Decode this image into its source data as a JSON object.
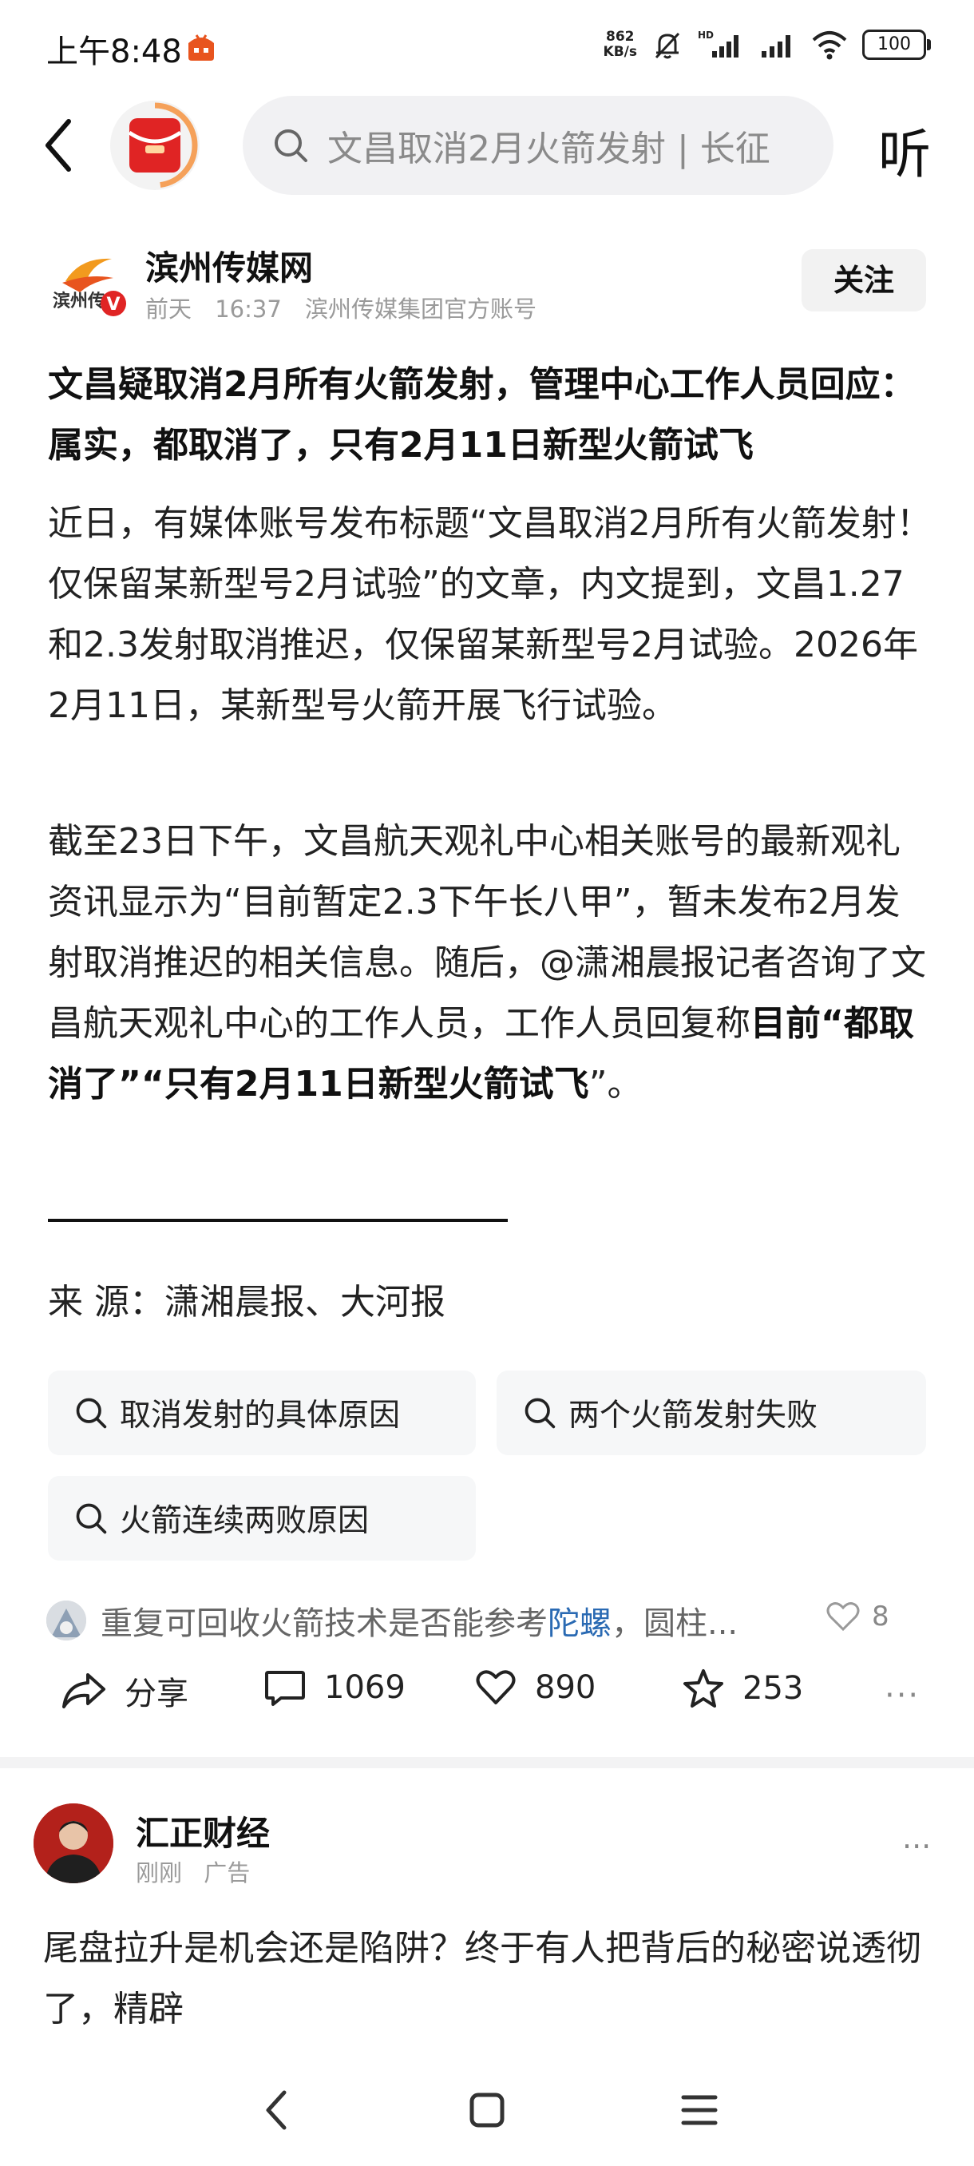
{
  "status_bar": {
    "time": "上午8:48",
    "net_speed_value": "862",
    "net_speed_unit": "KB/s",
    "battery": "100"
  },
  "header": {
    "search_text": "文昌取消2月火箭发射 | 长征",
    "listen_label": "听"
  },
  "author": {
    "name": "滨州传媒网",
    "logo_text": "滨州传",
    "verified_mark": "V",
    "meta": [
      "前天",
      "16:37",
      "滨州传媒集团官方账号"
    ],
    "follow_label": "关注"
  },
  "article": {
    "title": "文昌疑取消2月所有火箭发射，管理中心工作人员回应：属实，都取消了，只有2月11日新型火箭试飞",
    "para1": "近日，有媒体账号发布标题“文昌取消2月所有火箭发射！仅保留某新型号2月试验”的文章，内文提到，文昌1.27和2.3发射取消推迟，仅保留某新型号2月试验。2026年2月11日，某新型号火箭开展飞行试验。",
    "para2_normal": "截至23日下午，文昌航天观礼中心相关账号的最新观礼资讯显示为“目前暂定2.3下午长八甲”，暂未发布2月发射取消推迟的相关信息。随后，@潇湘晨报记者咨询了文昌航天观礼中心的工作人员，工作人员回复称",
    "para2_bold": "目前“都取消了”“只有2月11日新型火箭试飞",
    "para2_end": "”。",
    "source": "来 源：潇湘晨报、大河报"
  },
  "related_searches": [
    "取消发射的具体原因",
    "两个火箭发射失败",
    "火箭连续两败原因"
  ],
  "hot_comment": {
    "prefix": "重复可回收火箭技术是否能参考",
    "highlight": "陀螺",
    "suffix": "，圆柱...",
    "likes": "8"
  },
  "actions": {
    "share_label": "分享",
    "comments": "1069",
    "likes": "890",
    "favorites": "253",
    "more": "···"
  },
  "ad": {
    "name": "汇正财经",
    "meta": [
      "刚刚",
      "广告"
    ],
    "more": "···",
    "text": "尾盘拉升是机会还是陷阱？终于有人把背后的秘密说透彻了，精辟"
  },
  "colors": {
    "accent_red": "#e02424",
    "link_blue": "#2a6ab3",
    "chip_bg": "#f6f7f8",
    "search_bg": "#f1f1f3"
  }
}
